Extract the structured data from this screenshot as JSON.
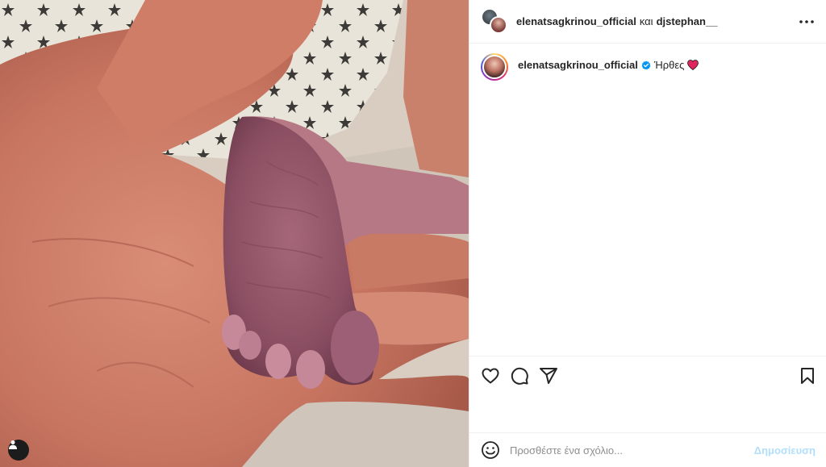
{
  "header": {
    "user1": "elenatsagkrinou_official",
    "conjunction": "και",
    "user2": "djstephan__"
  },
  "caption": {
    "user": "elenatsagkrinou_official",
    "text": "Ήρθες"
  },
  "comment": {
    "placeholder": "Προσθέστε ένα σχόλιο...",
    "post_label": "Δημοσίευση"
  },
  "icons": {
    "more": "more-horizontal-icon",
    "like": "heart-outline-icon",
    "comment": "comment-bubble-icon",
    "share": "paper-plane-icon",
    "save": "bookmark-icon",
    "emoji": "smiley-icon",
    "tag": "user-tag-icon",
    "verified": "verified-badge-icon",
    "heart_emoji": "red-heart-emoji"
  },
  "colors": {
    "verified_blue": "#0095f6",
    "heart_red": "#e0245e",
    "post_button_disabled": "#b2dffc"
  }
}
